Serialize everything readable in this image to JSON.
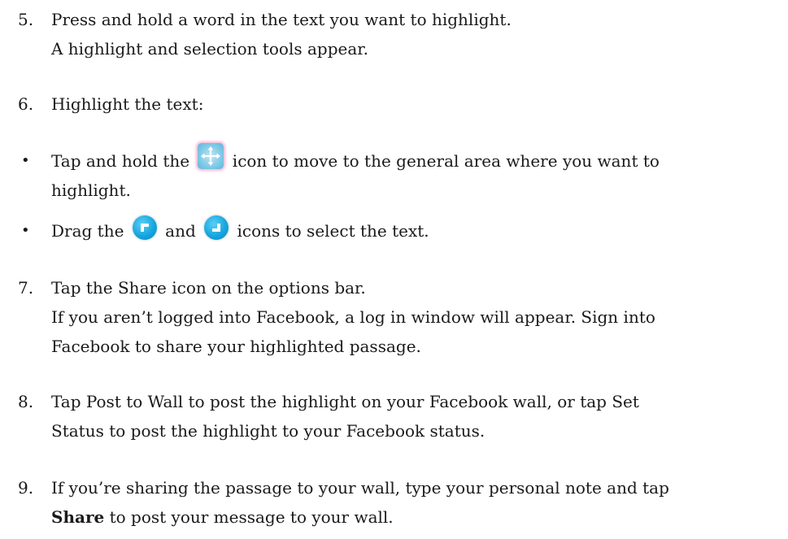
{
  "steps": {
    "s5": {
      "num": "5.",
      "line1": "Press and hold a word in the text you want to highlight.",
      "line2": "A highlight and selection tools appear."
    },
    "s6": {
      "num": "6.",
      "line1": "Highlight the text:"
    },
    "bullet1": {
      "dot": "•",
      "text_before_icon": "Tap and hold the",
      "text_after_icon": "icon to move to the general area where you want to",
      "line2": "highlight.",
      "icon": "move-handle-icon"
    },
    "bullet2": {
      "dot": "•",
      "text_before": "Drag the",
      "text_mid": "and",
      "text_after": "icons to select the text.",
      "icon_start": "selection-start-handle-icon",
      "icon_end": "selection-end-handle-icon"
    },
    "s7": {
      "num": "7.",
      "line1": "Tap the Share icon on the options bar.",
      "line2": "If you aren’t logged into Facebook, a log in window will appear. Sign into",
      "line3": "Facebook to share your highlighted passage."
    },
    "s8": {
      "num": "8.",
      "line1": "Tap Post to Wall to post the highlight on your Facebook wall, or tap Set",
      "line2": "Status to post the highlight to your Facebook status."
    },
    "s9": {
      "num": "9.",
      "line1": "If you’re sharing the passage to your wall, type your personal note and tap",
      "line2_bold": "Share",
      "line2_rest": " to post your message to your wall."
    }
  },
  "colors": {
    "text": "#1a1a1a",
    "handle_blue": "#16a6df",
    "move_icon_bg": "#8fd0ea"
  }
}
